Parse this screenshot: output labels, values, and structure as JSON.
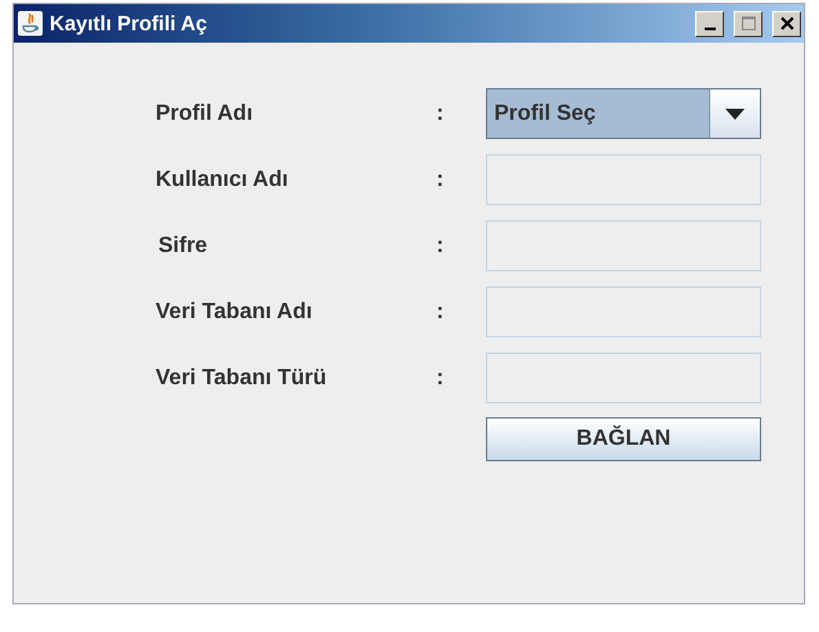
{
  "window": {
    "title": "Kayıtlı Profili Aç"
  },
  "fields": [
    {
      "label": "Profil Adı",
      "separator": ":",
      "kind": "dropdown",
      "value": "Profil Seç"
    },
    {
      "label": "Kullanıcı Adı",
      "separator": ":",
      "kind": "text"
    },
    {
      "label": "Sifre",
      "separator": ":",
      "kind": "text"
    },
    {
      "label": "Veri Tabanı Adı",
      "separator": ":",
      "kind": "text"
    },
    {
      "label": "Veri Tabanı Türü",
      "separator": ":",
      "kind": "text"
    }
  ],
  "buttons": [
    "BAĞLAN"
  ]
}
